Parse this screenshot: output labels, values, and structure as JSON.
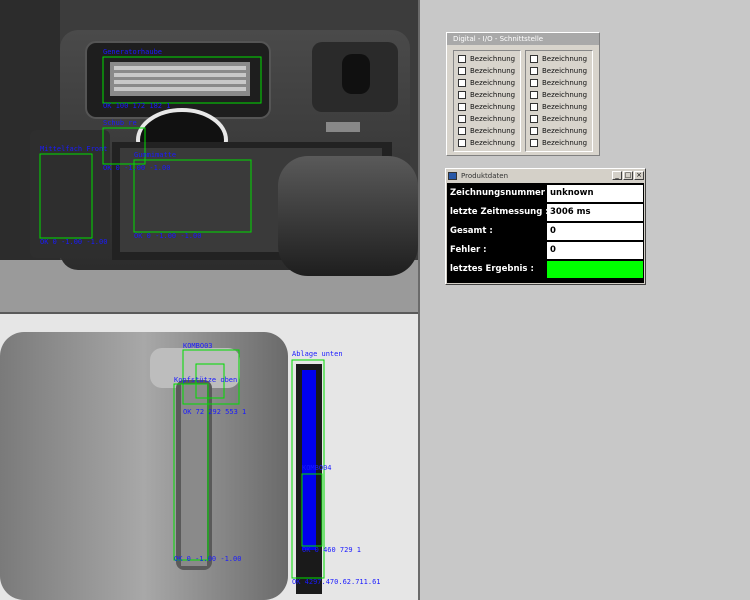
{
  "camera_top": {
    "roi_labels": [
      "Generatorhaube",
      "OK 100 172 182 1",
      "Schub re",
      "Mittelfach Front",
      "Gummimatte",
      "OK 0 -1.00 -1.00",
      "OK 0 -1.00 -1.00",
      "OK 0 -1.00 -1.00"
    ]
  },
  "camera_bottom": {
    "roi_labels": [
      "KOMBO03",
      "Kopfstütze oben",
      "OK 72 292 553 1",
      "OK 0 -1.00 -1.00",
      "Ablage unten",
      "KOMBO04",
      "OK 0 460 729 1",
      "OK 4297.470.62.711.61"
    ]
  },
  "io_panel": {
    "title": "Digital - I/O - Schnittstelle",
    "left_items": [
      "Bezeichnung",
      "Bezeichnung",
      "Bezeichnung",
      "Bezeichnung",
      "Bezeichnung",
      "Bezeichnung",
      "Bezeichnung",
      "Bezeichnung"
    ],
    "right_items": [
      "Bezeichnung",
      "Bezeichnung",
      "Bezeichnung",
      "Bezeichnung",
      "Bezeichnung",
      "Bezeichnung",
      "Bezeichnung",
      "Bezeichnung"
    ]
  },
  "product_window": {
    "title": "Produktdaten",
    "minimize": "_",
    "maximize": "□",
    "close": "×",
    "rows": [
      {
        "label": "Zeichnungsnummer  :",
        "value": "unknown"
      },
      {
        "label": "letzte Zeitmessung :",
        "value": "3006 ms"
      },
      {
        "label": "Gesamt :",
        "value": "0"
      },
      {
        "label": "Fehler :",
        "value": "0"
      },
      {
        "label": "letztes Ergebnis :",
        "value": ""
      }
    ],
    "result_color": "#00ff00"
  }
}
